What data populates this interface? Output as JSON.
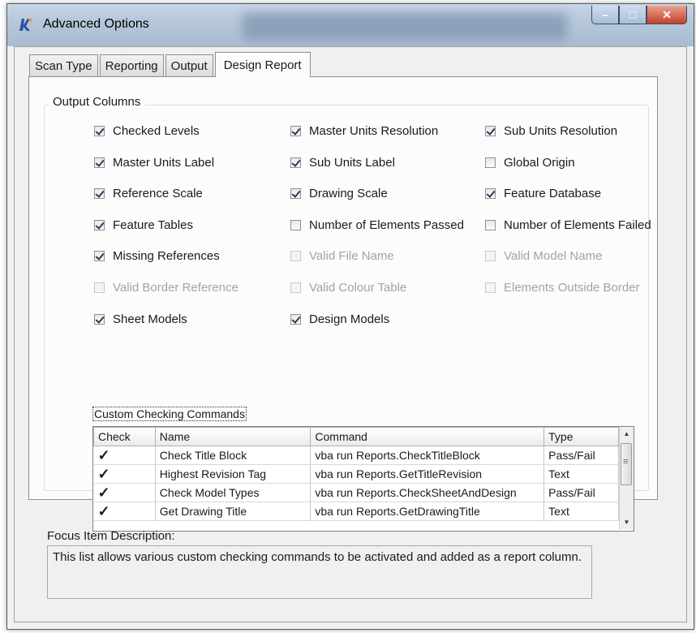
{
  "window": {
    "title": "Advanced Options"
  },
  "tabs": [
    "Scan Type",
    "Reporting",
    "Output",
    "Design Report"
  ],
  "active_tab": "Design Report",
  "output_columns": {
    "label": "Output Columns",
    "items": [
      {
        "label": "Checked Levels",
        "checked": true,
        "enabled": true
      },
      {
        "label": "Master Units Resolution",
        "checked": true,
        "enabled": true
      },
      {
        "label": "Sub Units Resolution",
        "checked": true,
        "enabled": true
      },
      {
        "label": "Master Units Label",
        "checked": true,
        "enabled": true
      },
      {
        "label": "Sub Units Label",
        "checked": true,
        "enabled": true
      },
      {
        "label": "Global Origin",
        "checked": false,
        "enabled": true
      },
      {
        "label": "Reference Scale",
        "checked": true,
        "enabled": true
      },
      {
        "label": "Drawing Scale",
        "checked": true,
        "enabled": true
      },
      {
        "label": "Feature Database",
        "checked": true,
        "enabled": true
      },
      {
        "label": "Feature Tables",
        "checked": true,
        "enabled": true
      },
      {
        "label": "Number of Elements Passed",
        "checked": false,
        "enabled": true
      },
      {
        "label": "Number of Elements Failed",
        "checked": false,
        "enabled": true
      },
      {
        "label": "Missing References",
        "checked": true,
        "enabled": true
      },
      {
        "label": "Valid File Name",
        "checked": false,
        "enabled": false
      },
      {
        "label": "Valid Model Name",
        "checked": false,
        "enabled": false
      },
      {
        "label": "Valid Border Reference",
        "checked": false,
        "enabled": false
      },
      {
        "label": "Valid Colour Table",
        "checked": false,
        "enabled": false
      },
      {
        "label": "Elements Outside Border",
        "checked": false,
        "enabled": false
      },
      {
        "label": "Sheet Models",
        "checked": true,
        "enabled": true
      },
      {
        "label": "Design Models",
        "checked": true,
        "enabled": true
      }
    ]
  },
  "custom_commands": {
    "label": "Custom Checking Commands",
    "columns": [
      "Check",
      "Name",
      "Command",
      "Type"
    ],
    "rows": [
      {
        "check": "✓",
        "name": "Check Title Block",
        "command": "vba run Reports.CheckTitleBlock",
        "type": "Pass/Fail"
      },
      {
        "check": "✓",
        "name": "Highest Revision Tag",
        "command": "vba run Reports.GetTitleRevision",
        "type": "Text"
      },
      {
        "check": "✓",
        "name": "Check Model Types",
        "command": "vba run Reports.CheckSheetAndDesign",
        "type": "Pass/Fail"
      },
      {
        "check": "✓",
        "name": "Get Drawing Title",
        "command": "vba run Reports.GetDrawingTitle",
        "type": "Text"
      }
    ]
  },
  "focus": {
    "label": "Focus Item Description:",
    "text": "This list allows various custom checking commands to be activated and added as a report column."
  }
}
